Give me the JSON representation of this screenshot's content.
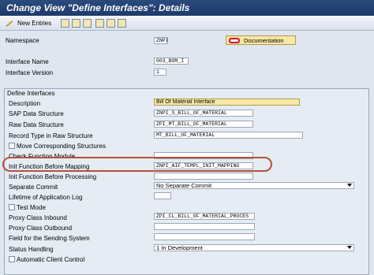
{
  "title": "Change View \"Define Interfaces\": Details",
  "toolbar": {
    "new_entries": "New Entries"
  },
  "header": {
    "namespace_label": "Namespace",
    "namespace_value": "ZNPI",
    "documentation_label": "Documentation",
    "interface_name_label": "Interface Name",
    "interface_name_value": "003_BOM_I",
    "interface_version_label": "Interface Version",
    "interface_version_value": "1"
  },
  "group": {
    "title": "Define Interfaces",
    "rows": [
      {
        "label": "Description",
        "value": "Bill Of Material Interface"
      },
      {
        "label": "SAP Data Structure",
        "value": "ZNPI_S_BILL_OF_MATERIAL"
      },
      {
        "label": "Raw Data Structure",
        "value": "ZPI_MT_BILL_OF_MATERIAL"
      },
      {
        "label": "Record Type in Raw Structure",
        "value": "MT_BILL_OF_MATERIAL"
      },
      {
        "label": "Move Corresponding Structures",
        "value": ""
      },
      {
        "label": "Check Function Module",
        "value": ""
      },
      {
        "label": "Init Function Before Mapping",
        "value": "ZNPI_AIF_TEMPL_INIT_MAPPING"
      },
      {
        "label": "Init Function Before Processing",
        "value": ""
      },
      {
        "label": "Separate Commit",
        "value": "No Separate Commit"
      },
      {
        "label": "Lifetime of Application Log",
        "value": ""
      },
      {
        "label": "Test Mode",
        "value": ""
      },
      {
        "label": "Proxy Class Inbound",
        "value": "ZPI_CL_BILL_OF_MATERIAL_PROCES"
      },
      {
        "label": "Proxy Class Outbound",
        "value": ""
      },
      {
        "label": "Field for the Sending System",
        "value": ""
      },
      {
        "label": "Status Handling",
        "value": "1 In Development"
      },
      {
        "label": "Automatic Client Control",
        "value": ""
      }
    ]
  }
}
